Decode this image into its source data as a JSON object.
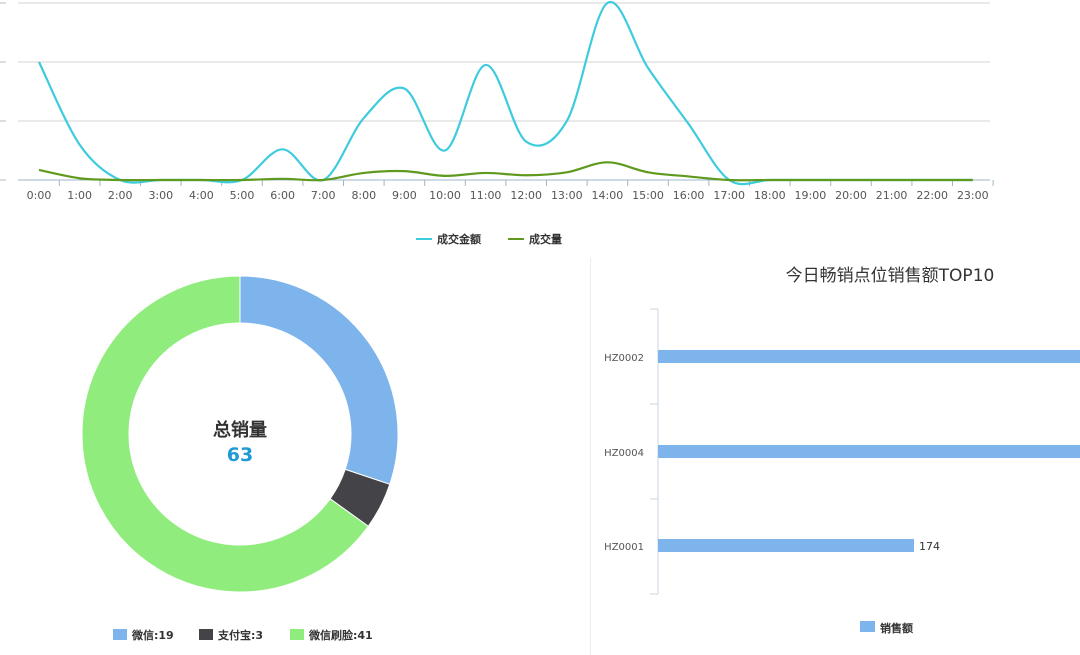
{
  "chart_data": [
    {
      "type": "line",
      "categories": [
        "0:00",
        "1:00",
        "2:00",
        "3:00",
        "4:00",
        "5:00",
        "6:00",
        "7:00",
        "8:00",
        "9:00",
        "10:00",
        "11:00",
        "12:00",
        "13:00",
        "14:00",
        "15:00",
        "16:00",
        "17:00",
        "18:00",
        "19:00",
        "20:00",
        "21:00",
        "22:00",
        "23:00"
      ],
      "ylim": [
        0,
        30
      ],
      "series": [
        {
          "name": "成交金额",
          "color": "#3ecbde",
          "values": [
            20,
            6,
            0,
            0,
            0,
            0,
            5.2,
            0,
            10.5,
            15.5,
            5,
            19.5,
            6.5,
            10,
            30,
            19,
            9.5,
            0,
            0,
            0,
            0,
            0,
            0,
            0
          ]
        },
        {
          "name": "成交量",
          "color": "#5f9a1f",
          "values": [
            1.7,
            0.3,
            0,
            0,
            0,
            0,
            0.2,
            0,
            1.2,
            1.5,
            0.7,
            1.2,
            0.8,
            1.3,
            3,
            1.3,
            0.6,
            0,
            0,
            0,
            0,
            0,
            0,
            0
          ]
        }
      ],
      "legend_position": "bottom",
      "grid": true
    },
    {
      "type": "pie",
      "center_label": "总销量",
      "center_value": "63",
      "center_value_color": "#1e9ad6",
      "slices": [
        {
          "name": "微信",
          "value": 19,
          "label": "微信:19",
          "color": "#7eb4ec"
        },
        {
          "name": "支付宝",
          "value": 3,
          "label": "支付宝:3",
          "color": "#434348"
        },
        {
          "name": "微信刷脸",
          "value": 41,
          "label": "微信刷脸:41",
          "color": "#90ed7d"
        }
      ],
      "legend_position": "bottom"
    },
    {
      "type": "bar",
      "orientation": "horizontal",
      "title": "今日畅销点位销售额TOP10",
      "categories": [
        "HZ0002",
        "HZ0004",
        "HZ0001"
      ],
      "series": [
        {
          "name": "销售额",
          "color": "#7eb4ec",
          "values": [
            null,
            null,
            174
          ]
        }
      ],
      "data_labels": [
        "",
        "",
        "174"
      ],
      "legend_position": "bottom"
    }
  ]
}
